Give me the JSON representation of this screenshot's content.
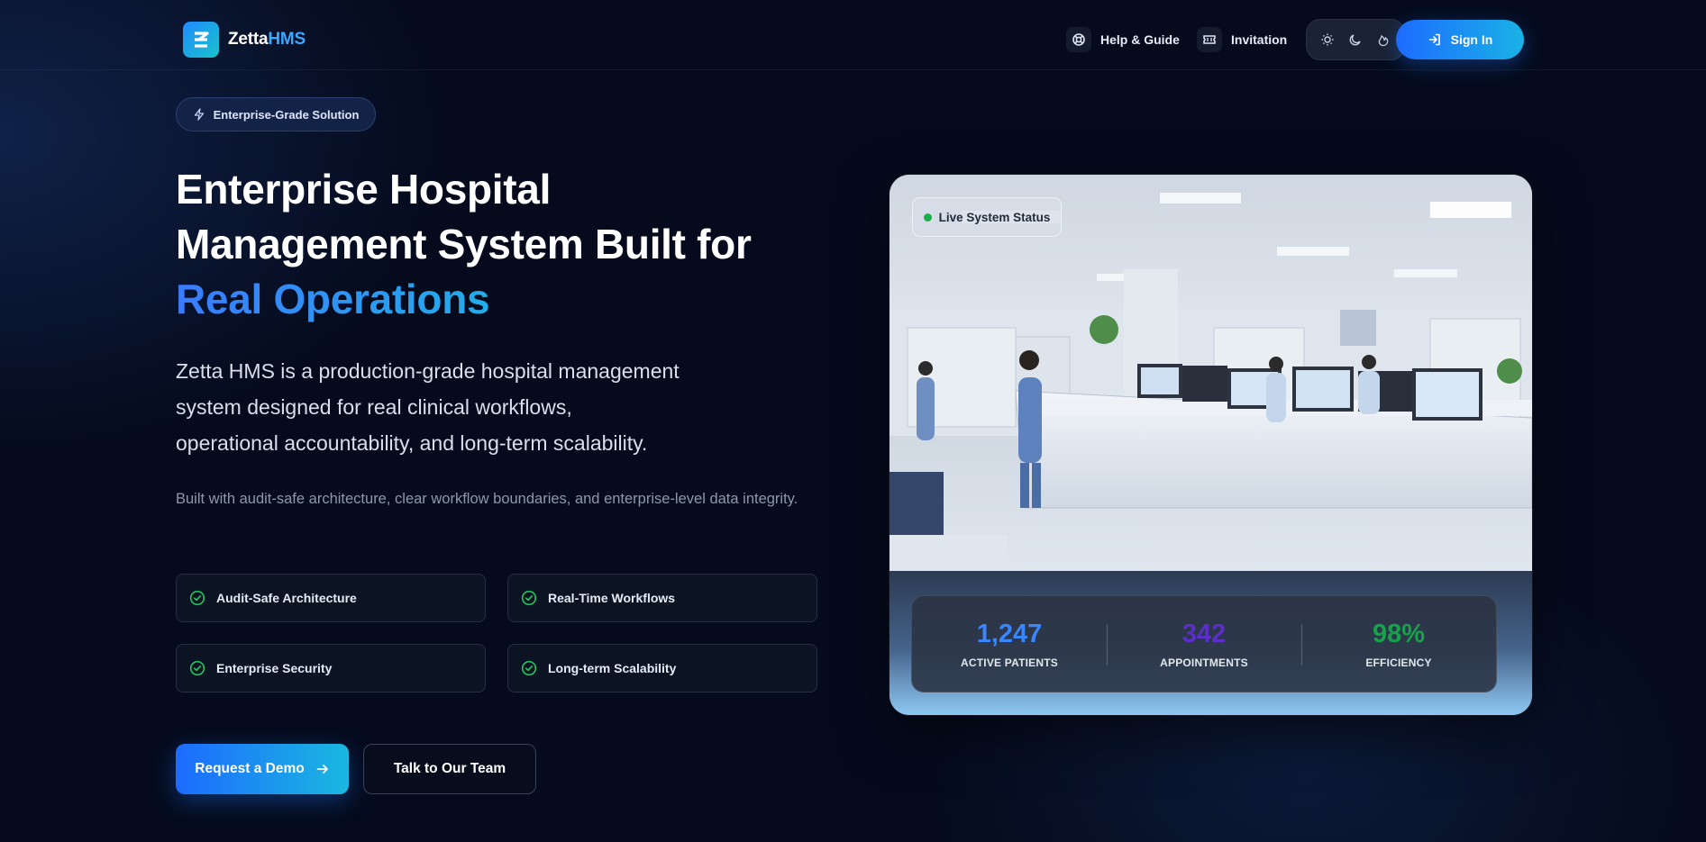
{
  "header": {
    "brand_prefix": "Zetta",
    "brand_suffix": "HMS",
    "nav": [
      {
        "label": "Help & Guide",
        "icon": "lifebuoy-icon"
      },
      {
        "label": "Invitation",
        "icon": "ticket-icon"
      }
    ],
    "theme_options": [
      "sun-icon",
      "moon-icon",
      "flame-icon"
    ],
    "signin_label": "Sign In"
  },
  "hero": {
    "badge": "Enterprise-Grade Solution",
    "title_line1": "Enterprise Hospital",
    "title_line2": "Management System Built for",
    "title_highlight": "Real Operations",
    "lead_line1": "Zetta HMS is a production-grade hospital management",
    "lead_line2": "system designed for real clinical workflows,",
    "lead_line3": "operational accountability, and long-term scalability.",
    "sub": "Built with audit-safe architecture, clear workflow boundaries, and enterprise-level data integrity.",
    "features": [
      "Audit-Safe Architecture",
      "Real-Time Workflows",
      "Enterprise Security",
      "Long-term Scalability"
    ],
    "cta_primary": "Request a Demo",
    "cta_secondary": "Talk to Our Team"
  },
  "showcase": {
    "status_label": "Live System Status",
    "stats": [
      {
        "value": "1,247",
        "label": "ACTIVE PATIENTS",
        "color": "#3a86ff"
      },
      {
        "value": "342",
        "label": "APPOINTMENTS",
        "color": "#5b2fc9"
      },
      {
        "value": "98%",
        "label": "EFFICIENCY",
        "color": "#16a34a"
      }
    ]
  },
  "colors": {
    "background": "#050b1d",
    "accent_blue": "#1d6bff",
    "accent_cyan": "#19b8e0",
    "check_green": "#22c55e"
  }
}
